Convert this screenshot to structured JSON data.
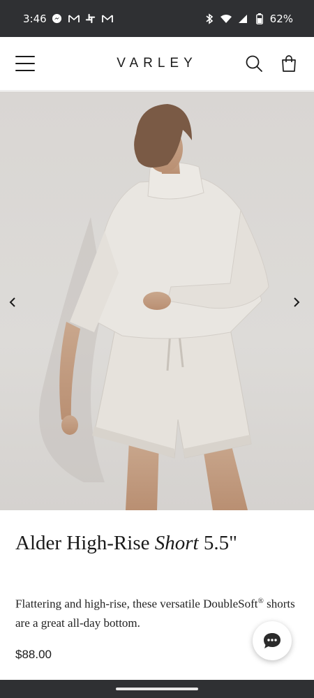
{
  "status_bar": {
    "time": "3:46",
    "battery": "62%",
    "left_icons": [
      "messenger-icon",
      "gmail-icon",
      "slack-icon",
      "gmail-icon"
    ],
    "right_icons": [
      "bluetooth-icon",
      "wifi-icon",
      "signal-icon",
      "battery-icon"
    ]
  },
  "header": {
    "logo": "VARLEY",
    "icons": [
      "menu-icon",
      "search-icon",
      "shopping-bag-icon"
    ]
  },
  "carousel": {
    "image_alt": "Model wearing Alder High-Rise Short 5.5 and sweatshirt",
    "prev_icon": "chevron-left-icon",
    "next_icon": "chevron-right-icon"
  },
  "product": {
    "title_main": "Alder High-Rise ",
    "title_italic": "Short",
    "title_size": " 5.5\"",
    "description_part1": "Flattering and high-rise, these versatile DoubleSoft",
    "description_reg": "®",
    "description_part2": " shorts are a great all-day bottom.",
    "price": "$88.00"
  },
  "chat": {
    "icon": "chat-bubble-icon"
  },
  "colors": {
    "status_bar": "#2f3033",
    "hero_bg": "#d9d6d3",
    "text": "#1a1a1a"
  }
}
